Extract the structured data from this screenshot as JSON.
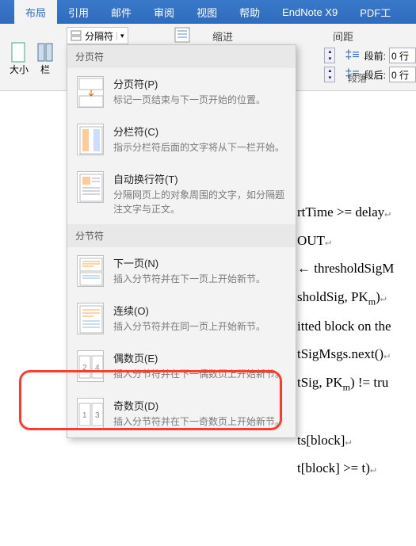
{
  "tabs": {
    "layout": "布局",
    "references": "引用",
    "mailings": "邮件",
    "review": "审阅",
    "view": "视图",
    "help": "帮助",
    "endnote": "EndNote X9",
    "pdf": "PDF工"
  },
  "ribbon": {
    "breaks_label": "分隔符",
    "size_label": "大小",
    "columns_label": "栏",
    "indent_label": "缩进",
    "spacing_label": "间距",
    "before_label": "段前:",
    "after_label": "段后:",
    "before_value": "0 行",
    "after_value": "0 行",
    "paragraph_label": "段落"
  },
  "dropdown": {
    "group1_header": "分页符",
    "items": [
      {
        "title": "分页符(P)",
        "desc": "标记一页结束与下一页开始的位置。"
      },
      {
        "title": "分栏符(C)",
        "desc": "指示分栏符后面的文字将从下一栏开始。"
      },
      {
        "title": "自动换行符(T)",
        "desc": "分隔网页上的对象周围的文字，如分隔题注文字与正文。"
      }
    ],
    "group2_header": "分节符",
    "items2": [
      {
        "title": "下一页(N)",
        "desc": "插入分节符并在下一页上开始新节。"
      },
      {
        "title": "连续(O)",
        "desc": "插入分节符并在同一页上开始新节。"
      },
      {
        "title": "偶数页(E)",
        "desc": "插入分节符并在下一偶数页上开始新节。"
      },
      {
        "title": "奇数页(D)",
        "desc": "插入分节符并在下一奇数页上开始新节。"
      }
    ]
  },
  "doc": {
    "l1a": "rtTime >= delay",
    "l2": "OUT",
    "l3": "← thresholdSigM",
    "l4a": "sholdSig, PK",
    "l4b": "m",
    "l4c": ")",
    "l5": "itted block on the",
    "l6": "tSigMsgs.next()",
    "l7a": "tSig, PK",
    "l7b": "m",
    "l7c": ") != tru",
    "l8": "ts[block]",
    "l9": "t[block] >= t)"
  }
}
